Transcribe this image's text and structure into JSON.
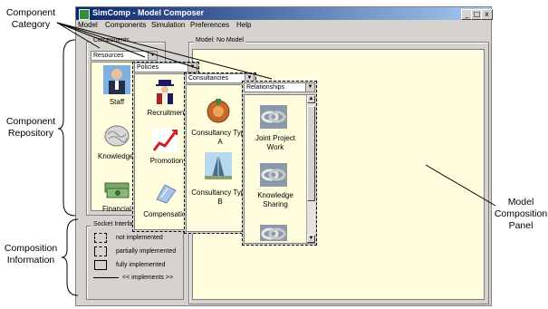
{
  "annotations": {
    "component_category": [
      "Component",
      "Category"
    ],
    "component_repository": [
      "Component",
      "Repository"
    ],
    "composition_information": [
      "Composition",
      "Information"
    ],
    "model_composition_panel": [
      "Model",
      "Composition",
      "Panel"
    ]
  },
  "window": {
    "title": "SimComp - Model Composer",
    "buttons": [
      "_",
      "□",
      "x"
    ]
  },
  "menu": [
    "Model",
    "Components",
    "Simulation",
    "Preferences",
    "Help"
  ],
  "repository": {
    "group_label": "Components",
    "lists": [
      {
        "category": "Resources",
        "items": [
          "Staff",
          "Knowledge",
          "Financial"
        ]
      },
      {
        "category": "Policies",
        "items": [
          "Recruitment",
          "Promotion",
          "Compensation"
        ]
      },
      {
        "category": "Consultancies",
        "items": [
          "Consultancy Type A",
          "Consultancy Type B"
        ]
      },
      {
        "category": "Relationships",
        "items": [
          "Joint Project Work",
          "Knowledge Sharing"
        ]
      }
    ]
  },
  "model_panel": {
    "label": "Model: No Model"
  },
  "socket_status": {
    "label": "Socket Interface Status",
    "legend": [
      "not implemented",
      "partially implemented",
      "fully implemented",
      "<< implements >>"
    ]
  }
}
